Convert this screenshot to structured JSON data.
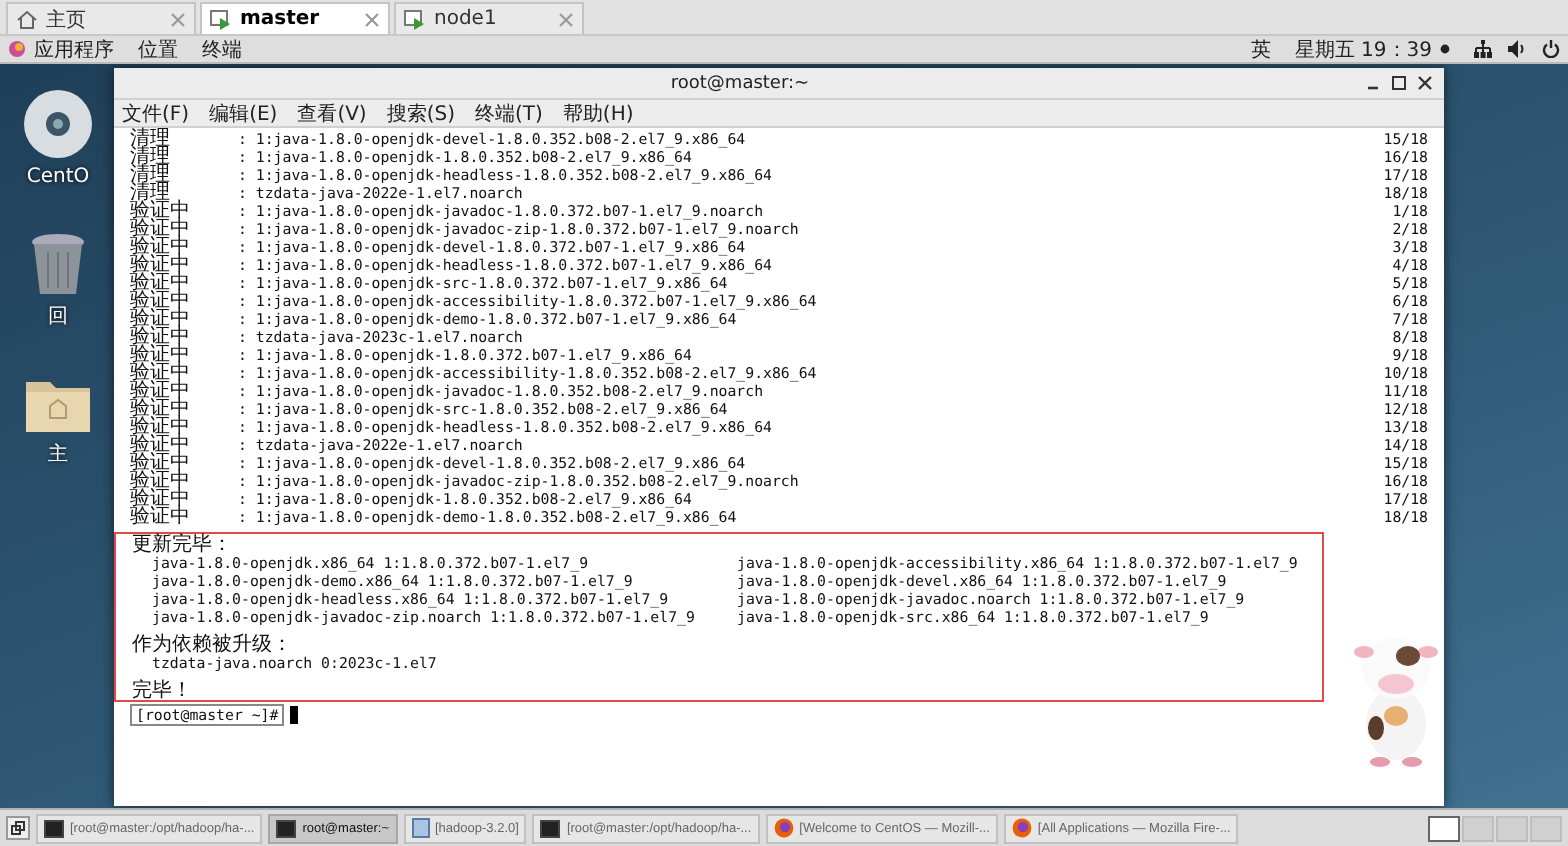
{
  "vm_tabs": [
    {
      "label": "主页",
      "kind": "home",
      "selected": false
    },
    {
      "label": "master",
      "kind": "vm",
      "selected": true
    },
    {
      "label": "node1",
      "kind": "vm",
      "selected": false
    }
  ],
  "top_panel": {
    "menus": [
      "应用程序",
      "位置",
      "终端"
    ],
    "input_method": "英",
    "clock": "星期五 19：39"
  },
  "desktop_icons": [
    {
      "label": "CentO",
      "kind": "disc"
    },
    {
      "label": "回",
      "kind": "trash"
    },
    {
      "label": "主",
      "kind": "folder"
    }
  ],
  "terminal": {
    "title": "root@master:~",
    "menu": [
      "文件(F)",
      "编辑(E)",
      "查看(V)",
      "搜索(S)",
      "终端(T)",
      "帮助(H)"
    ],
    "lines": [
      {
        "status": "清理",
        "package": ": 1:java-1.8.0-openjdk-devel-1.8.0.352.b08-2.el7_9.x86_64",
        "progress": "15/18"
      },
      {
        "status": "清理",
        "package": ": 1:java-1.8.0-openjdk-1.8.0.352.b08-2.el7_9.x86_64",
        "progress": "16/18"
      },
      {
        "status": "清理",
        "package": ": 1:java-1.8.0-openjdk-headless-1.8.0.352.b08-2.el7_9.x86_64",
        "progress": "17/18"
      },
      {
        "status": "清理",
        "package": ": tzdata-java-2022e-1.el7.noarch",
        "progress": "18/18"
      },
      {
        "status": "验证中",
        "package": ": 1:java-1.8.0-openjdk-javadoc-1.8.0.372.b07-1.el7_9.noarch",
        "progress": "1/18"
      },
      {
        "status": "验证中",
        "package": ": 1:java-1.8.0-openjdk-javadoc-zip-1.8.0.372.b07-1.el7_9.noarch",
        "progress": "2/18"
      },
      {
        "status": "验证中",
        "package": ": 1:java-1.8.0-openjdk-devel-1.8.0.372.b07-1.el7_9.x86_64",
        "progress": "3/18"
      },
      {
        "status": "验证中",
        "package": ": 1:java-1.8.0-openjdk-headless-1.8.0.372.b07-1.el7_9.x86_64",
        "progress": "4/18"
      },
      {
        "status": "验证中",
        "package": ": 1:java-1.8.0-openjdk-src-1.8.0.372.b07-1.el7_9.x86_64",
        "progress": "5/18"
      },
      {
        "status": "验证中",
        "package": ": 1:java-1.8.0-openjdk-accessibility-1.8.0.372.b07-1.el7_9.x86_64",
        "progress": "6/18"
      },
      {
        "status": "验证中",
        "package": ": 1:java-1.8.0-openjdk-demo-1.8.0.372.b07-1.el7_9.x86_64",
        "progress": "7/18"
      },
      {
        "status": "验证中",
        "package": ": tzdata-java-2023c-1.el7.noarch",
        "progress": "8/18"
      },
      {
        "status": "验证中",
        "package": ": 1:java-1.8.0-openjdk-1.8.0.372.b07-1.el7_9.x86_64",
        "progress": "9/18"
      },
      {
        "status": "验证中",
        "package": ": 1:java-1.8.0-openjdk-accessibility-1.8.0.352.b08-2.el7_9.x86_64",
        "progress": "10/18"
      },
      {
        "status": "验证中",
        "package": ": 1:java-1.8.0-openjdk-javadoc-1.8.0.352.b08-2.el7_9.noarch",
        "progress": "11/18"
      },
      {
        "status": "验证中",
        "package": ": 1:java-1.8.0-openjdk-src-1.8.0.352.b08-2.el7_9.x86_64",
        "progress": "12/18"
      },
      {
        "status": "验证中",
        "package": ": 1:java-1.8.0-openjdk-headless-1.8.0.352.b08-2.el7_9.x86_64",
        "progress": "13/18"
      },
      {
        "status": "验证中",
        "package": ": tzdata-java-2022e-1.el7.noarch",
        "progress": "14/18"
      },
      {
        "status": "验证中",
        "package": ": 1:java-1.8.0-openjdk-devel-1.8.0.352.b08-2.el7_9.x86_64",
        "progress": "15/18"
      },
      {
        "status": "验证中",
        "package": ": 1:java-1.8.0-openjdk-javadoc-zip-1.8.0.352.b08-2.el7_9.noarch",
        "progress": "16/18"
      },
      {
        "status": "验证中",
        "package": ": 1:java-1.8.0-openjdk-1.8.0.352.b08-2.el7_9.x86_64",
        "progress": "17/18"
      },
      {
        "status": "验证中",
        "package": ": 1:java-1.8.0-openjdk-demo-1.8.0.352.b08-2.el7_9.x86_64",
        "progress": "18/18"
      }
    ],
    "summary": {
      "updated_title": "更新完毕：",
      "updated": [
        "java-1.8.0-openjdk.x86_64 1:1.8.0.372.b07-1.el7_9",
        "java-1.8.0-openjdk-accessibility.x86_64 1:1.8.0.372.b07-1.el7_9",
        "java-1.8.0-openjdk-demo.x86_64 1:1.8.0.372.b07-1.el7_9",
        "java-1.8.0-openjdk-devel.x86_64 1:1.8.0.372.b07-1.el7_9",
        "java-1.8.0-openjdk-headless.x86_64 1:1.8.0.372.b07-1.el7_9",
        "java-1.8.0-openjdk-javadoc.noarch 1:1.8.0.372.b07-1.el7_9",
        "java-1.8.0-openjdk-javadoc-zip.noarch 1:1.8.0.372.b07-1.el7_9",
        "java-1.8.0-openjdk-src.x86_64 1:1.8.0.372.b07-1.el7_9"
      ],
      "dependency_title": "作为依赖被升级：",
      "dependencies": [
        "tzdata-java.noarch 0:2023c-1.el7"
      ],
      "done": "完毕！"
    },
    "prompt": "[root@master ~]#"
  },
  "taskbar": {
    "items": [
      {
        "label": "[root@master:/opt/hadoop/ha-...",
        "kind": "terminal",
        "selected": false
      },
      {
        "label": "root@master:~",
        "kind": "terminal",
        "selected": true
      },
      {
        "label": "[hadoop-3.2.0]",
        "kind": "files",
        "selected": false
      },
      {
        "label": "[root@master:/opt/hadoop/ha-...",
        "kind": "terminal",
        "selected": false
      },
      {
        "label": "[Welcome to CentOS — Mozill-...",
        "kind": "browser",
        "selected": false
      },
      {
        "label": "[All Applications — Mozilla Fire-...",
        "kind": "browser",
        "selected": false
      }
    ],
    "workspaces": [
      {
        "selected": true
      },
      {
        "selected": false
      },
      {
        "selected": false
      },
      {
        "selected": false
      }
    ]
  }
}
